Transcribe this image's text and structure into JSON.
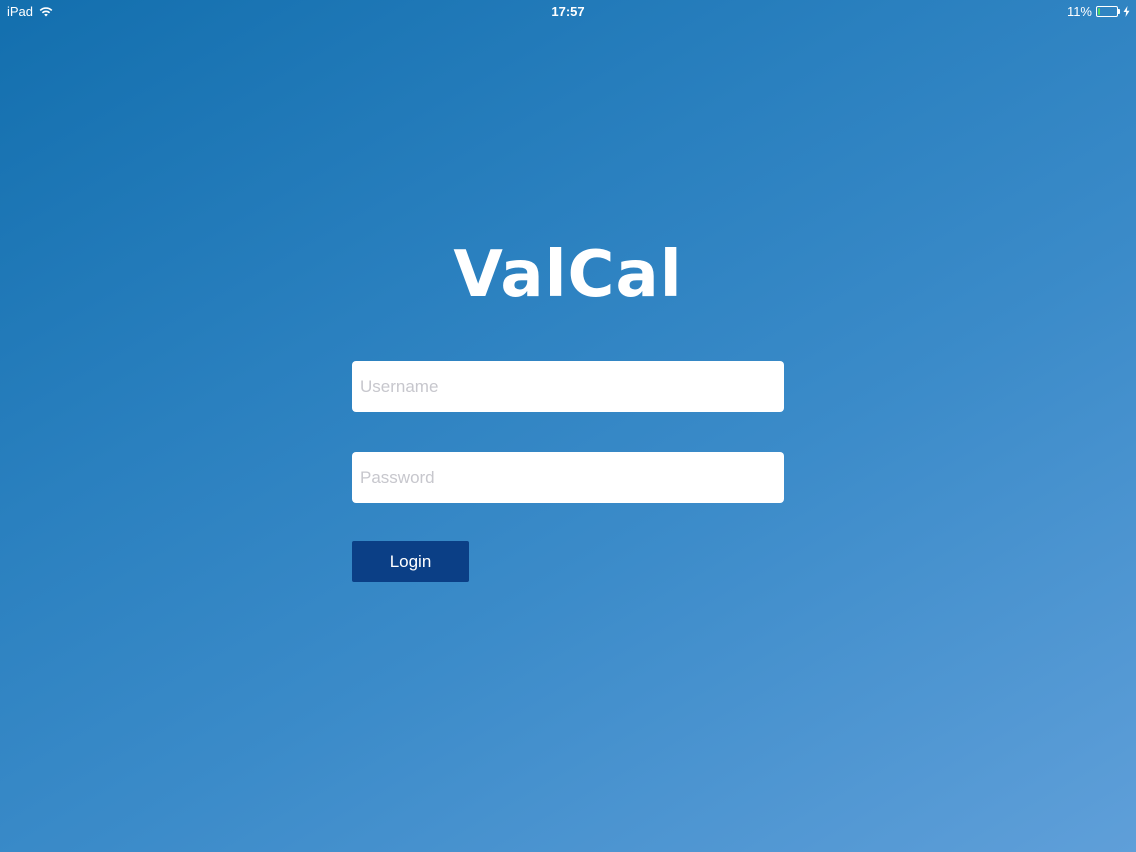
{
  "status_bar": {
    "device": "iPad",
    "time": "17:57",
    "battery_percent_label": "11%",
    "battery_level": 0.11,
    "wifi_icon": "wifi-icon",
    "battery_icon": "battery-icon",
    "charging_icon": "charging-bolt-icon"
  },
  "app": {
    "title": "ValCal"
  },
  "login_form": {
    "username_placeholder": "Username",
    "username_value": "",
    "password_placeholder": "Password",
    "password_value": "",
    "login_label": "Login"
  },
  "colors": {
    "background_top": "#136fae",
    "background_bottom": "#5f9fd9",
    "button": "#0b3f86",
    "battery_fill": "#4cd964"
  }
}
